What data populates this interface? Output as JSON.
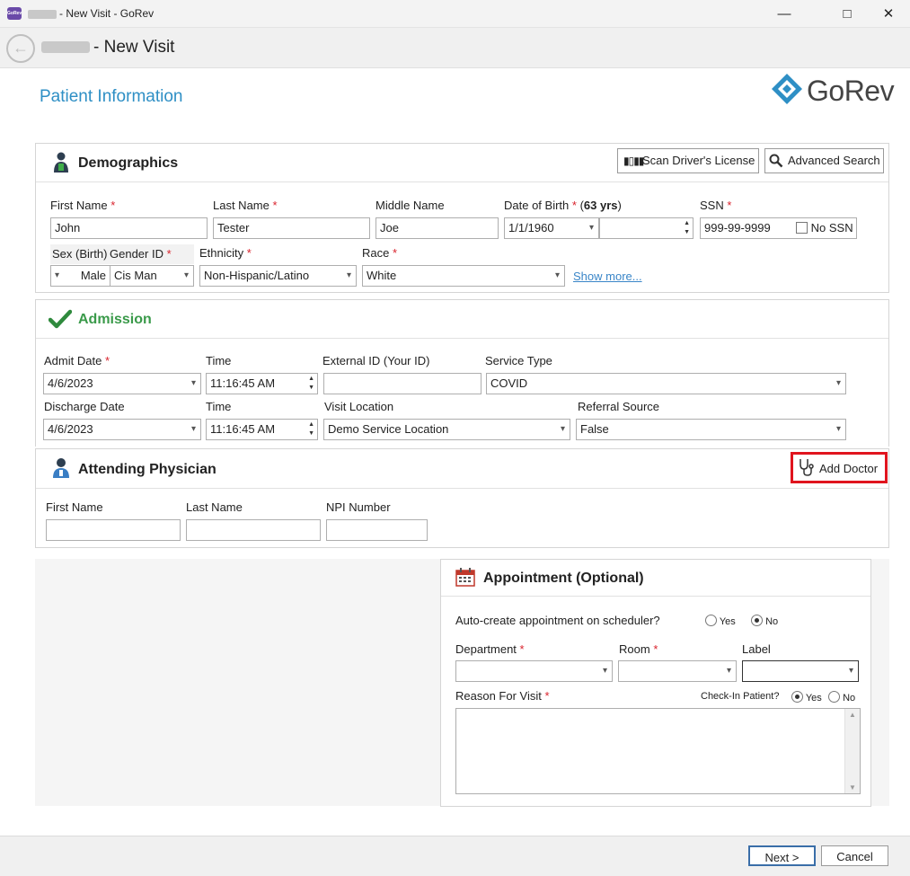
{
  "window": {
    "title": "- New Visit - GoRev",
    "app_icon_text": "GoRev",
    "minimize_icon": "minimize-icon",
    "maximize_icon": "maximize-icon",
    "close_icon": "close-icon"
  },
  "header": {
    "title": "- New Visit"
  },
  "page": {
    "title": "Patient Information",
    "logo_text": "GoRev"
  },
  "demographics": {
    "title": "Demographics",
    "scan_button": "Scan Driver's License",
    "search_button": "Advanced Search",
    "first_name_label": "First Name",
    "first_name_value": "John",
    "last_name_label": "Last Name",
    "last_name_value": "Tester",
    "middle_name_label": "Middle Name",
    "middle_name_value": "Joe",
    "dob_label": "Date of Birth",
    "age_text": "63 yrs",
    "dob_value": "1/1/1960",
    "ssn_label": "SSN",
    "ssn_value": "999-99-9999",
    "no_ssn_label": "No SSN",
    "sex_label": "Sex (Birth)",
    "sex_value": "Male",
    "gender_label": "Gender ID",
    "gender_value": "Cis Man",
    "ethnicity_label": "Ethnicity",
    "ethnicity_value": "Non-Hispanic/Latino",
    "race_label": "Race",
    "race_value": "White",
    "show_more": "Show more..."
  },
  "admission": {
    "title": "Admission",
    "admit_date_label": "Admit Date",
    "admit_date_value": "4/6/2023",
    "time_label": "Time",
    "admit_time_value": "11:16:45 AM",
    "external_id_label": "External ID (Your ID)",
    "external_id_value": "",
    "service_type_label": "Service Type",
    "service_type_value": "COVID",
    "discharge_date_label": "Discharge Date",
    "discharge_date_value": "4/6/2023",
    "discharge_time_label": "Time",
    "discharge_time_value": "11:16:45 AM",
    "visit_location_label": "Visit Location",
    "visit_location_value": "Demo Service Location",
    "referral_source_label": "Referral Source",
    "referral_source_value": "False"
  },
  "physician": {
    "title": "Attending Physician",
    "add_doctor_button": "Add Doctor",
    "first_name_label": "First Name",
    "last_name_label": "Last Name",
    "npi_label": "NPI Number"
  },
  "appointment": {
    "title": "Appointment (Optional)",
    "auto_create_label": "Auto-create appointment on scheduler?",
    "yes_label": "Yes",
    "no_label": "No",
    "auto_create_selected": "No",
    "department_label": "Department",
    "room_label": "Room",
    "label_label": "Label",
    "reason_label": "Reason For Visit",
    "checkin_label": "Check-In Patient?",
    "checkin_yes": "Yes",
    "checkin_no": "No",
    "checkin_selected": "Yes"
  },
  "footer": {
    "next_button": "Next >",
    "cancel_button": "Cancel"
  },
  "colors": {
    "accent_blue": "#2e8fc5",
    "admission_green": "#3a9a4a",
    "required_red": "#d9232d",
    "highlight_red": "#e0141e"
  }
}
